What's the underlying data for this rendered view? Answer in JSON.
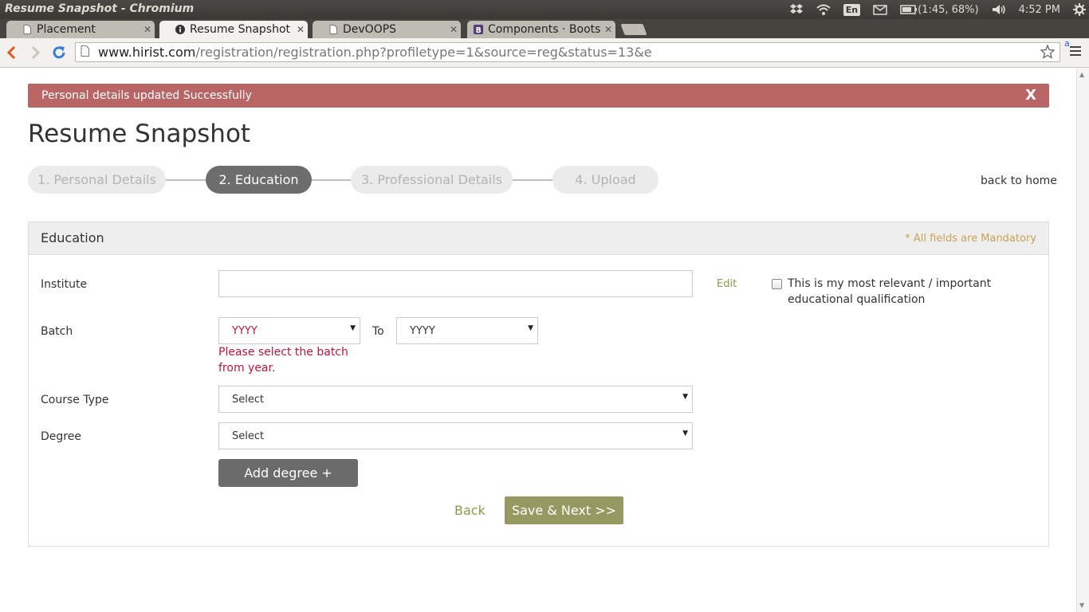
{
  "os_panel": {
    "window_title": "Resume Snapshot - Chromium",
    "language": "En",
    "battery": "(1:45, 68%)",
    "clock": "4:52 PM"
  },
  "tabs": [
    {
      "title": "Placement",
      "icon": "page-icon",
      "active": false
    },
    {
      "title": "Resume Snapshot",
      "icon": "info-icon",
      "active": true
    },
    {
      "title": "DevOOPS",
      "icon": "page-icon",
      "active": false
    },
    {
      "title": "Components · Bootstr",
      "icon": "bootstrap-icon",
      "active": false
    }
  ],
  "address_bar": {
    "host": "www.hirist.com",
    "path": "/registration/registration.php?profiletype=1&source=reg&status=13&e",
    "extension_badge": "a"
  },
  "alert": {
    "message": "Personal details updated Successfully",
    "close": "X",
    "color": "#b96565"
  },
  "page": {
    "title": "Resume Snapshot",
    "back_home": "back to home"
  },
  "steps": [
    {
      "label": "1. Personal Details",
      "active": false
    },
    {
      "label": "2. Education",
      "active": true
    },
    {
      "label": "3. Professional Details",
      "active": false
    },
    {
      "label": "4. Upload",
      "active": false
    }
  ],
  "education_form": {
    "heading": "Education",
    "mandatory_note": "* All fields are Mandatory",
    "institute": {
      "label": "Institute",
      "value": "",
      "edit_link": "Edit"
    },
    "relevant_checkbox": {
      "checked": false,
      "label_line1": "This is my most relevant / important",
      "label_line2": "educational qualification"
    },
    "batch": {
      "label": "Batch",
      "from_value": "YYYY",
      "to_label": "To",
      "to_value": "YYYY",
      "error_line1": "Please select the batch",
      "error_line2": "from year."
    },
    "course_type": {
      "label": "Course Type",
      "value": "Select"
    },
    "degree": {
      "label": "Degree",
      "value": "Select"
    },
    "add_degree_button": "Add degree +",
    "back_link": "Back",
    "save_button": "Save & Next >>",
    "colors": {
      "accent_olive": "#979963",
      "error_red": "#c0143c",
      "mandatory_gold": "#c8a356"
    }
  }
}
